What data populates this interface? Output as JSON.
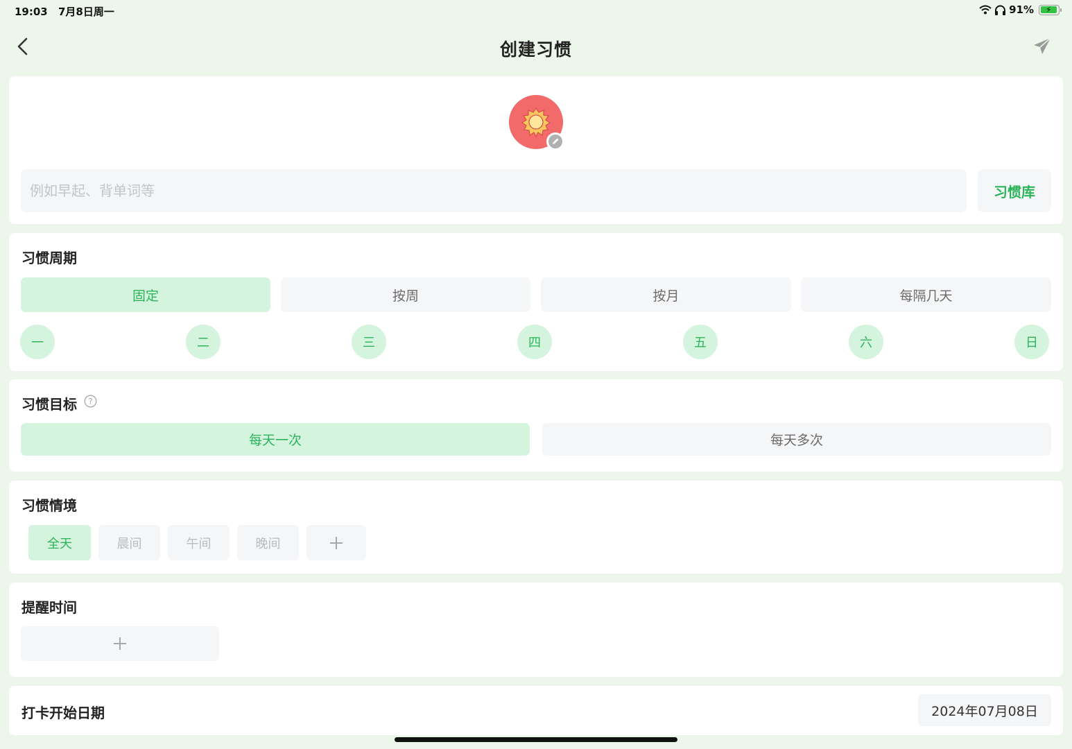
{
  "status_bar": {
    "time": "19:03",
    "date": "7月8日周一",
    "battery": "91%"
  },
  "nav": {
    "title": "创建习惯"
  },
  "habit": {
    "name_placeholder": "例如早起、背单词等",
    "library_label": "习惯库",
    "icon_color": "#f26a6a"
  },
  "cycle": {
    "title": "习惯周期",
    "options": [
      "固定",
      "按周",
      "按月",
      "每隔几天"
    ],
    "selected": "固定",
    "days": [
      "一",
      "二",
      "三",
      "四",
      "五",
      "六",
      "日"
    ]
  },
  "goal": {
    "title": "习惯目标",
    "options": [
      "每天一次",
      "每天多次"
    ],
    "selected": "每天一次"
  },
  "context": {
    "title": "习惯情境",
    "options": [
      "全天",
      "晨间",
      "午间",
      "晚间"
    ],
    "selected": "全天"
  },
  "reminder": {
    "title": "提醒时间"
  },
  "start": {
    "title": "打卡开始日期",
    "date": "2024年07月08日"
  },
  "colors": {
    "accent": "#2bb45a",
    "accent_bg": "#d5f4de",
    "page_bg": "#ecf6ea"
  }
}
